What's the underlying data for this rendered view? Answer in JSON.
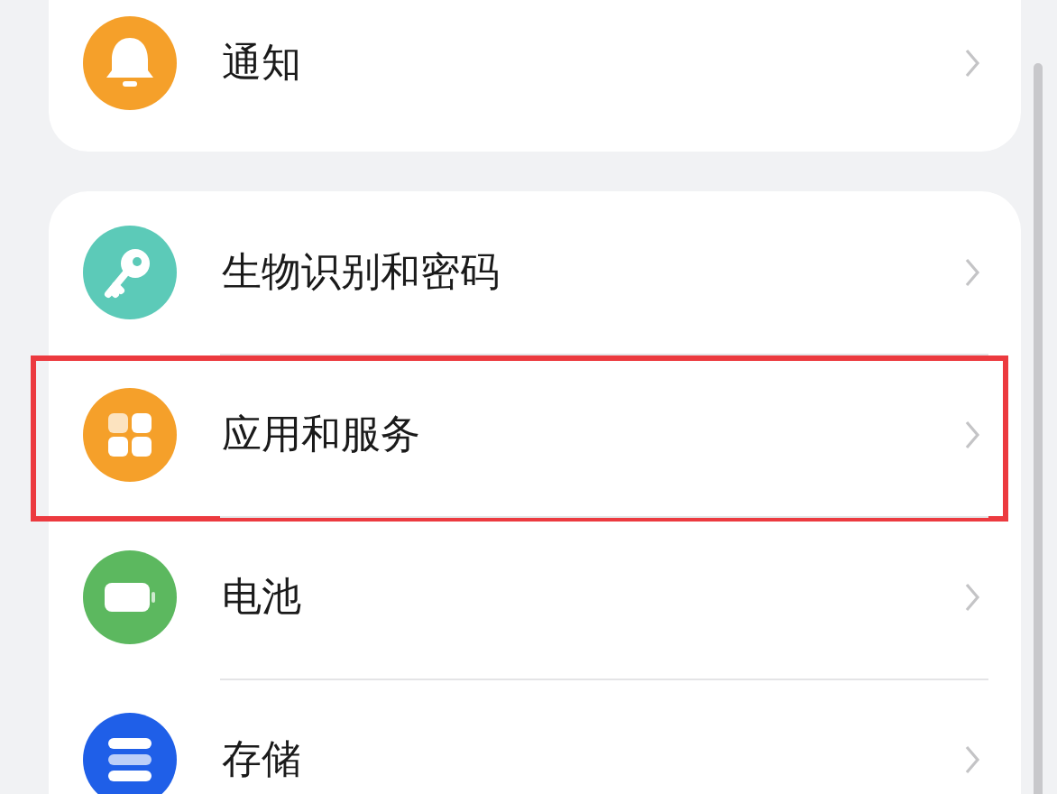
{
  "sections": [
    {
      "rows": [
        {
          "kind": "bell",
          "label": "通知",
          "color": "#f5a02a",
          "highlighted": false
        }
      ]
    },
    {
      "rows": [
        {
          "kind": "key",
          "label": "生物识别和密码",
          "color": "#5ccab8",
          "highlighted": false
        },
        {
          "kind": "grid",
          "label": "应用和服务",
          "color": "#f5a02a",
          "highlighted": true
        },
        {
          "kind": "battery",
          "label": "电池",
          "color": "#5cb85f",
          "highlighted": false
        },
        {
          "kind": "storage",
          "label": "存储",
          "color": "#1f5fe8",
          "highlighted": false
        }
      ]
    }
  ]
}
